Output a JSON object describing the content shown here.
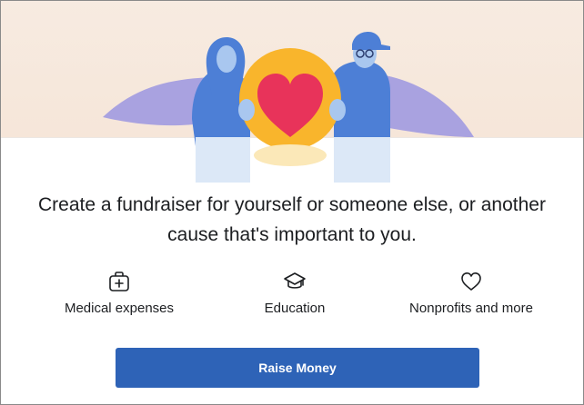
{
  "headline": "Create a fundraiser for yourself or someone else, or another cause that's important to you.",
  "categories": [
    {
      "label": "Medical expenses",
      "icon": "medical-kit-icon"
    },
    {
      "label": "Education",
      "icon": "graduation-cap-icon"
    },
    {
      "label": "Nonprofits and more",
      "icon": "heart-outline-icon"
    }
  ],
  "raise_button": {
    "label": "Raise Money"
  },
  "colors": {
    "hero_background": "#f7ebe1",
    "button_blue": "#2e63b7",
    "heart_red": "#e8335a",
    "circle_yellow": "#f9b52c",
    "figure_blue": "#4d7fd6",
    "figure_lavender": "#a9a2e0",
    "text": "#1c1e21"
  }
}
